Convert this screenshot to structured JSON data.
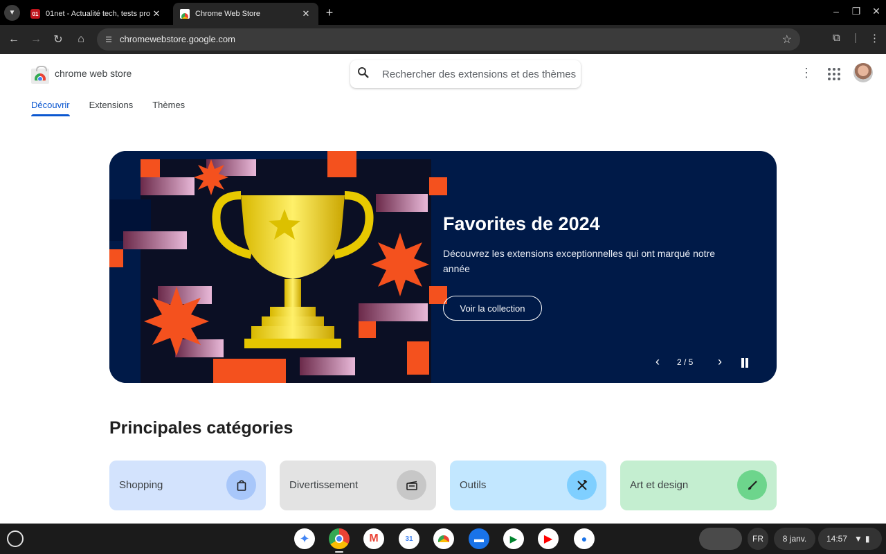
{
  "tabs": [
    {
      "title": "01net - Actualité tech, tests pro",
      "favicon": "01net-favicon-icon"
    },
    {
      "title": "Chrome Web Store",
      "favicon": "chrome-web-store-favicon-icon"
    }
  ],
  "toolbar": {
    "url": "chromewebstore.google.com"
  },
  "header": {
    "brand": "chrome web store",
    "search_placeholder": "Rechercher des extensions et des thèmes"
  },
  "nav": {
    "items": [
      "Découvrir",
      "Extensions",
      "Thèmes"
    ],
    "active": "Découvrir"
  },
  "banner": {
    "title": "Favorites de 2024",
    "subtitle": "Découvrez les extensions exceptionnelles qui ont marqué notre année",
    "button": "Voir la collection",
    "counter": "2 / 5"
  },
  "categories": {
    "title": "Principales catégories",
    "items": [
      {
        "label": "Shopping",
        "icon": "shopping-bag-icon",
        "bg": "#d3e3fd",
        "icon_bg": "#a8c7fa"
      },
      {
        "label": "Divertissement",
        "icon": "clapperboard-icon",
        "bg": "#e3e3e3",
        "icon_bg": "#c7c7c7"
      },
      {
        "label": "Outils",
        "icon": "tools-icon",
        "bg": "#c2e7ff",
        "icon_bg": "#7fcfff"
      },
      {
        "label": "Art et design",
        "icon": "brush-icon",
        "bg": "#c4eed0",
        "icon_bg": "#6dd58c"
      }
    ]
  },
  "shelf": {
    "lang": "FR",
    "date": "8 janv.",
    "time": "14:57"
  },
  "colors": {
    "accent": "#0b57d0",
    "banner_bg": "#001a48",
    "orange": "#f4511e"
  }
}
